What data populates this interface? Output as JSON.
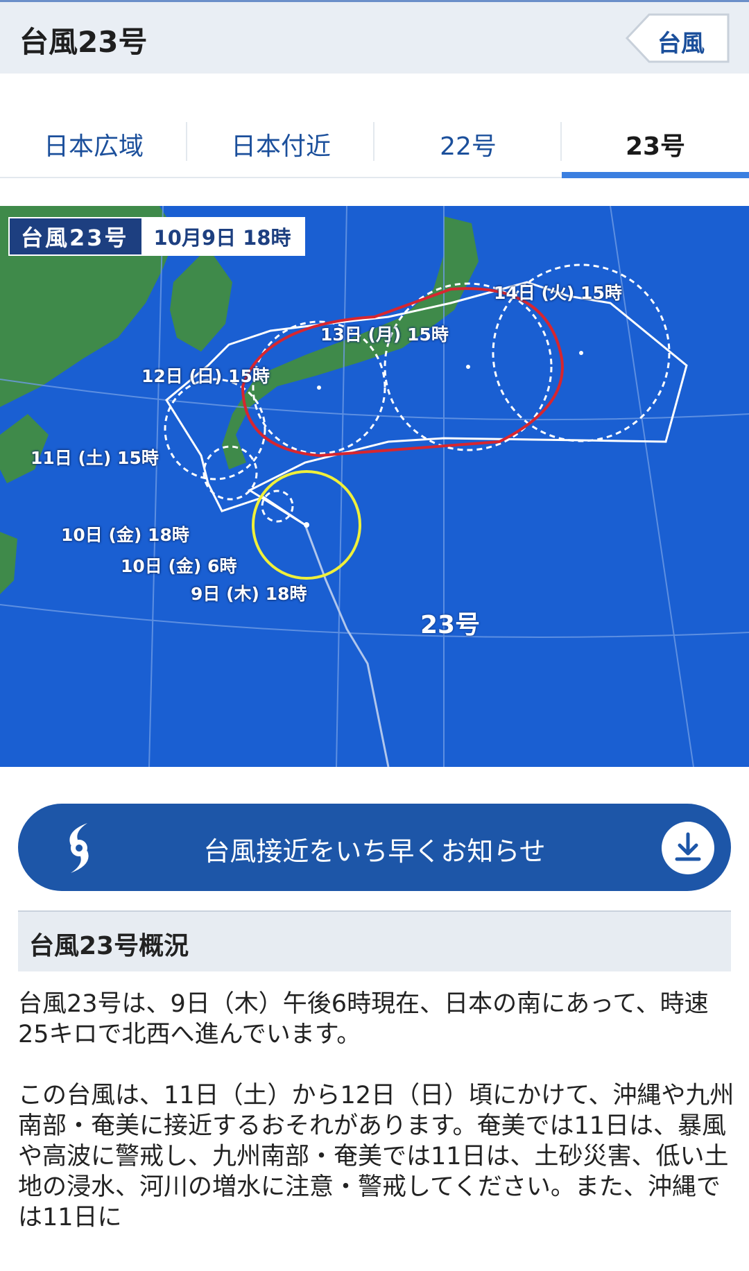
{
  "header": {
    "title": "台風23号",
    "back_label": "台風"
  },
  "tabs": [
    {
      "label": "日本広域",
      "active": false
    },
    {
      "label": "日本付近",
      "active": false
    },
    {
      "label": "22号",
      "active": false
    },
    {
      "label": "23号",
      "active": true
    }
  ],
  "map": {
    "badge_name": "台風23号",
    "badge_time": "10月9日 18時",
    "typhoon_label": "23号",
    "forecast_points": [
      {
        "label": "14日 (火) 15時"
      },
      {
        "label": "13日 (月) 15時"
      },
      {
        "label": "12日 (日) 15時"
      },
      {
        "label": "11日 (土) 15時"
      },
      {
        "label": "10日 (金) 18時"
      },
      {
        "label": "10日 (金) 6時"
      },
      {
        "label": "9日 (木) 18時"
      }
    ],
    "colors": {
      "sea": "#1a5fd2",
      "land": "#3f8a4a",
      "storm_warning_area": "#d7262f",
      "current_storm_zone": "#f0f03a",
      "forecast_circle": "#ffffff"
    }
  },
  "notify": {
    "label": "台風接近をいち早くお知らせ",
    "left_icon": "typhoon-icon",
    "right_icon": "download-icon"
  },
  "summary": {
    "heading": "台風23号概況",
    "paragraphs": [
      "台風23号は、9日（木）午後6時現在、日本の南にあって、時速25キロで北西へ進んでいます。",
      "この台風は、11日（土）から12日（日）頃にかけて、沖縄や九州南部・奄美に接近するおそれがあります。奄美では11日は、暴風や高波に警戒し、九州南部・奄美では11日は、土砂災害、低い土地の浸水、河川の増水に注意・警戒してください。また、沖縄では11日に"
    ]
  }
}
